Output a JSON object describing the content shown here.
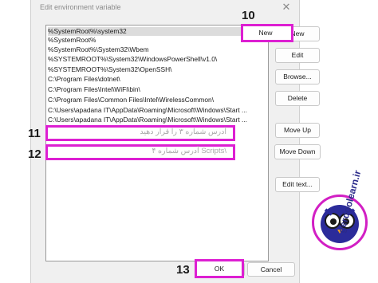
{
  "window": {
    "title": "Edit environment variable",
    "close_glyph": "✕"
  },
  "list": {
    "items": [
      "%SystemRoot%\\system32",
      "%SystemRoot%",
      "%SystemRoot%\\System32\\Wbem",
      "%SYSTEMROOT%\\System32\\WindowsPowerShell\\v1.0\\",
      "%SYSTEMROOT%\\System32\\OpenSSH\\",
      "C:\\Program Files\\dotnet\\",
      "C:\\Program Files\\Intel\\WiFi\\bin\\",
      "C:\\Program Files\\Common Files\\Intel\\WirelessCommon\\",
      "C:\\Users\\apadana IT\\AppData\\Roaming\\Microsoft\\Windows\\Start ...",
      "C:\\Users\\apadana IT\\AppData\\Roaming\\Microsoft\\Windows\\Start ..."
    ],
    "entry_11_text": "آدرس شماره ۳ را قرار دهید",
    "entry_12_text": "\\Scripts آدرس شماره ۴"
  },
  "buttons": {
    "new": "New",
    "edit": "Edit",
    "browse": "Browse...",
    "delete": "Delete",
    "move_up": "Move Up",
    "move_down": "Move Down",
    "edit_text": "Edit text...",
    "ok": "OK",
    "cancel": "Cancel"
  },
  "annotations": {
    "step_10": "10",
    "step_11": "11",
    "step_12": "12",
    "step_13": "13",
    "highlight_color": "#dd1fd2"
  },
  "logo": {
    "text": "gerdoolearn.ir"
  }
}
